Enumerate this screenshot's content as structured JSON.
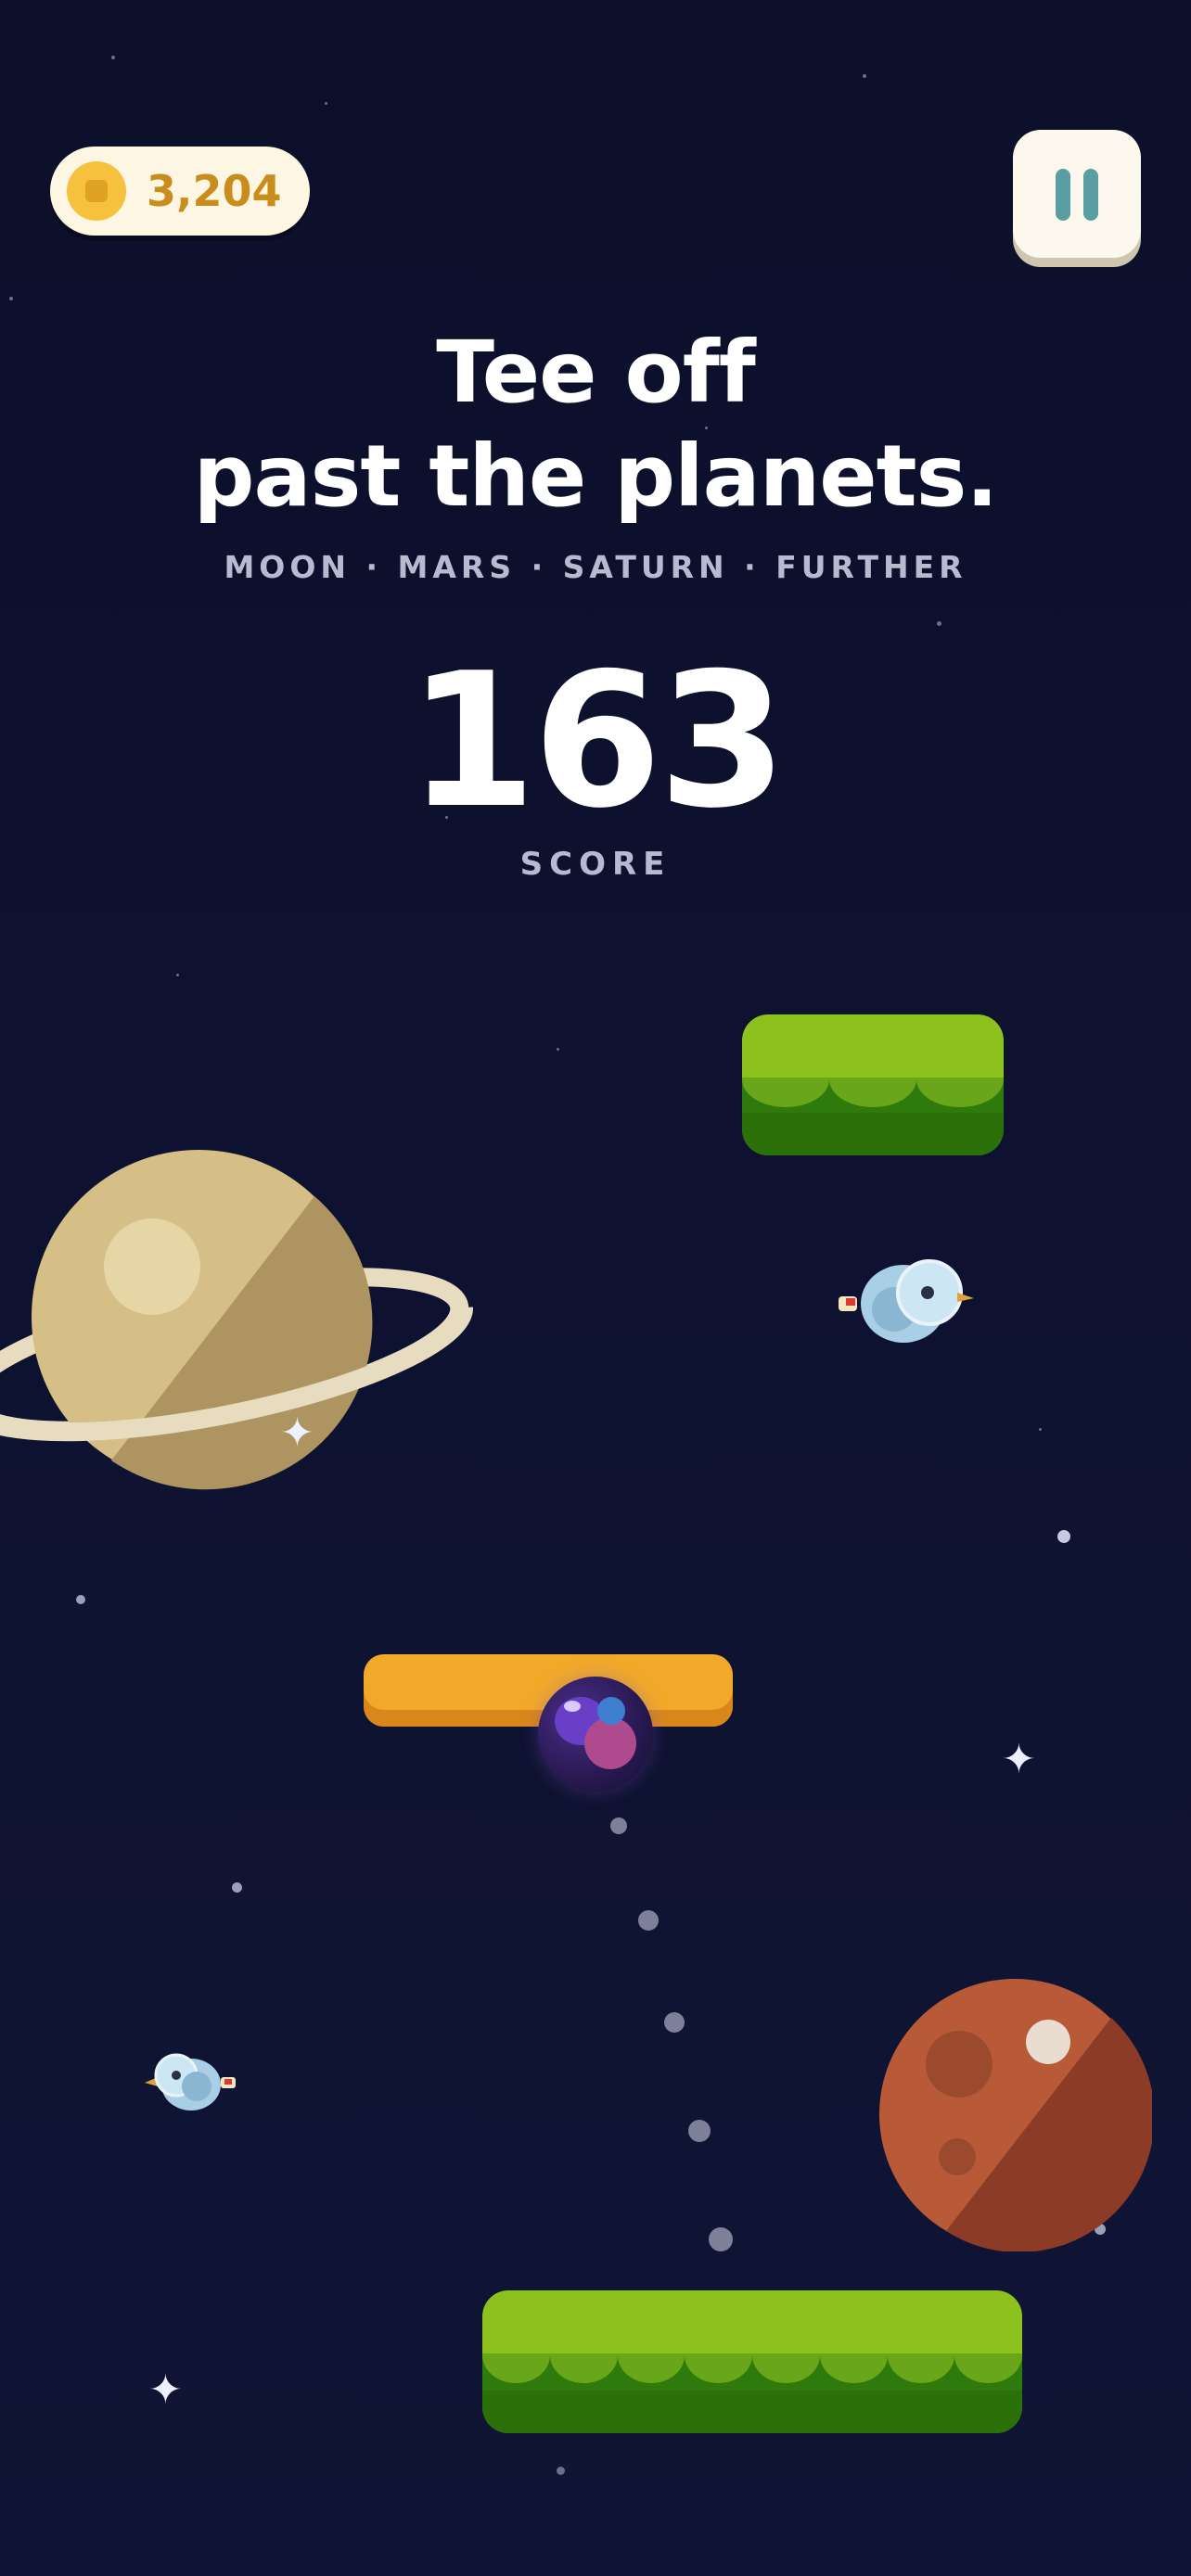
{
  "hud": {
    "coins": "3,204",
    "pause_icon": "pause-icon",
    "coin_icon": "coin-icon"
  },
  "headline": {
    "line1": "Tee off",
    "line2": "past the planets.",
    "subtitle": "MOON · MARS · SATURN · FURTHER"
  },
  "score": {
    "value": "163",
    "label": "SCORE"
  },
  "colors": {
    "background": "#0e1230",
    "grass_top": "#8dc21e",
    "grass_bottom": "#2f7a0c",
    "orange_platform": "#f2a92a",
    "coin": "#f6c23d",
    "saturn": "#d5bf86",
    "mars": "#b85a38"
  }
}
